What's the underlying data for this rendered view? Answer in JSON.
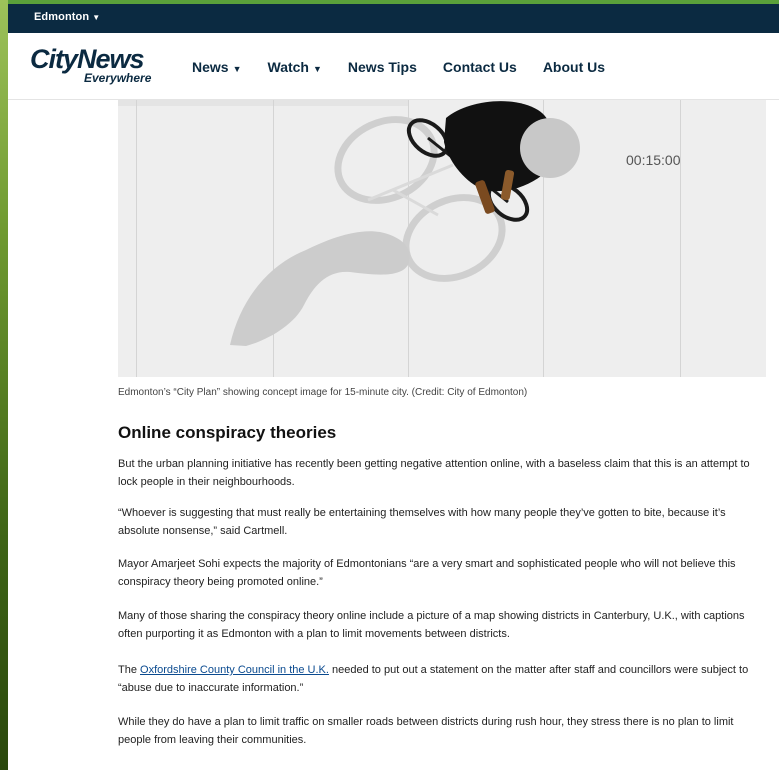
{
  "topbar": {
    "region": "Edmonton"
  },
  "brand": {
    "city": "CityNews",
    "tagline": "Everywhere"
  },
  "nav": [
    {
      "label": "News",
      "dropdown": true
    },
    {
      "label": "Watch",
      "dropdown": true
    },
    {
      "label": "News Tips",
      "dropdown": false
    },
    {
      "label": "Contact Us",
      "dropdown": false
    },
    {
      "label": "About Us",
      "dropdown": false
    }
  ],
  "hero": {
    "timer": "00:15:00"
  },
  "caption": "Edmonton’s “City Plan” showing concept image for 15-minute city. (Credit: City of Edmonton)",
  "article": {
    "heading": "Online conspiracy theories",
    "p1": "But the urban planning initiative has recently been getting negative attention online, with a baseless claim that this is an attempt to lock people in their neighbourhoods.",
    "p2": "“Whoever is suggesting that must really be entertaining themselves with how many people they’ve gotten to bite, because it’s absolute nonsense,” said Cartmell.",
    "p3": "Mayor Amarjeet Sohi expects the majority of Edmontonians “are a very smart and sophisticated people who will not believe this conspiracy theory being promoted online.”",
    "p4": "Many of those sharing the conspiracy theory online include a picture of a map showing districts in Canterbury, U.K., with captions often purporting it as Edmonton with a plan to limit movements between districts.",
    "p5_prefix": "The ",
    "p5_link": "Oxfordshire County Council in the U.K.",
    "p5_suffix": " needed to put out a statement on the matter after staff and councillors were subject to “abuse due to inaccurate information.”",
    "p6": "While they do have a plan to limit traffic on smaller roads between districts during rush hour, they stress there is no plan to limit people from leaving their communities."
  },
  "colors": {
    "navy": "#0b2a41",
    "accent_green": "#5aa03a",
    "link": "#0a4a8f"
  }
}
